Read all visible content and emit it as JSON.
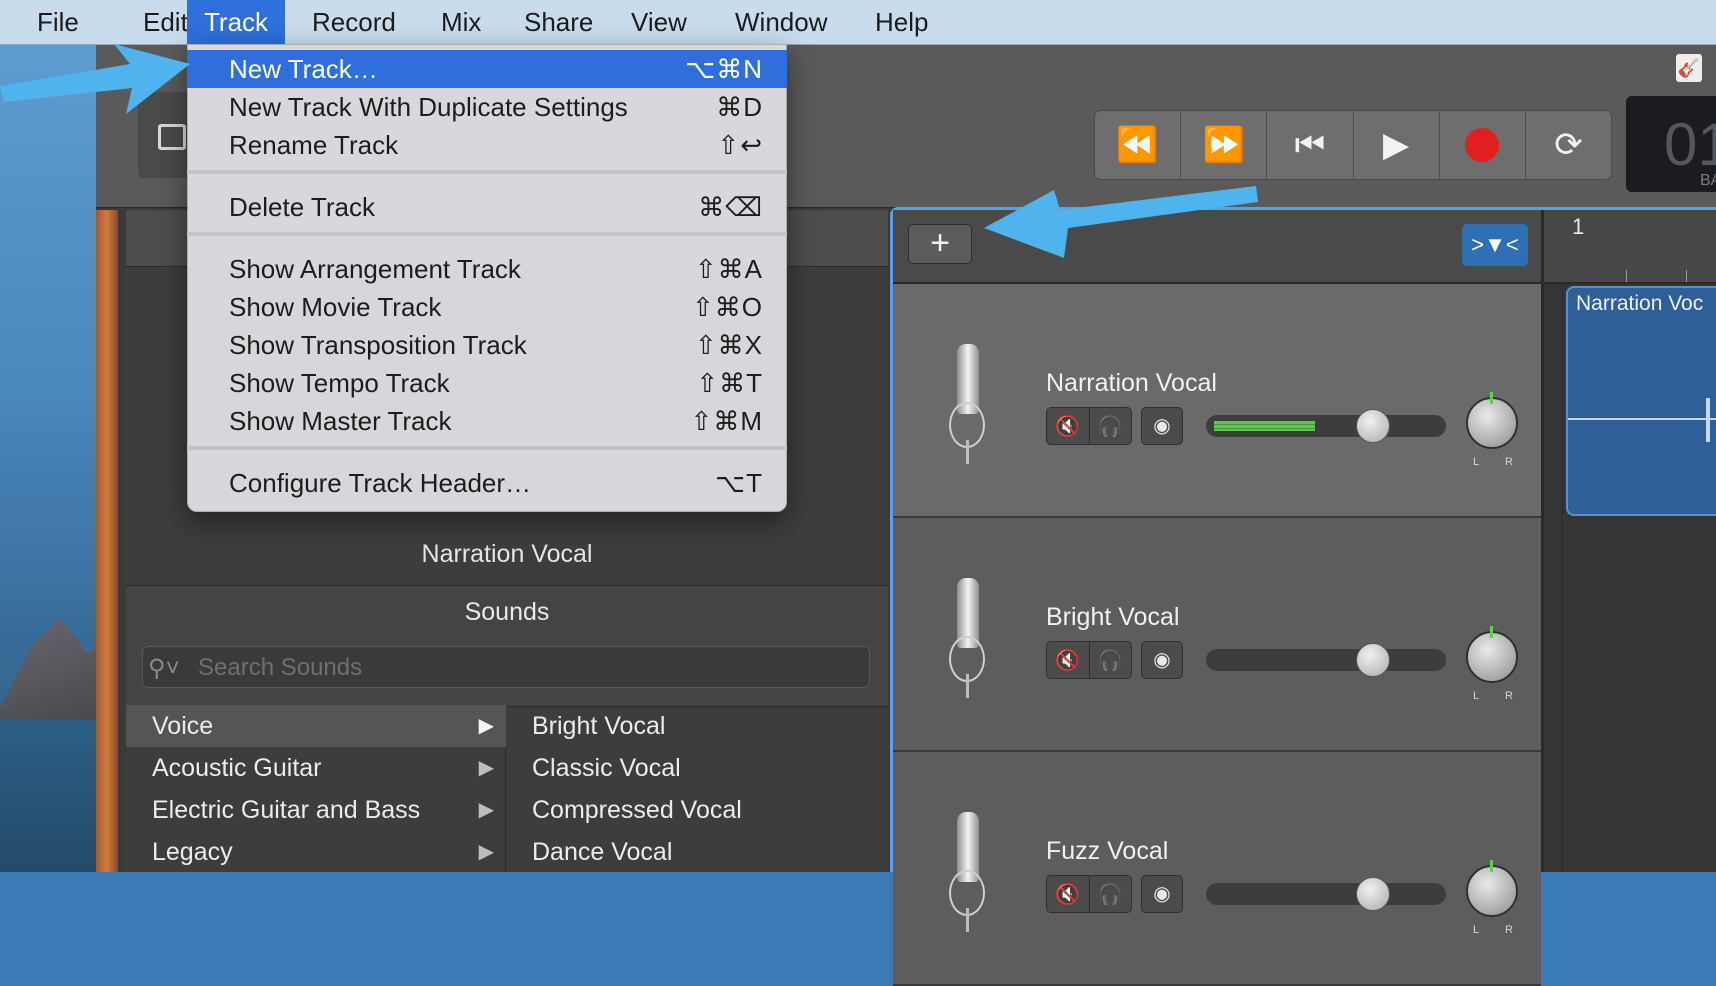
{
  "menubar": {
    "items": [
      "File",
      "Edit",
      "Track",
      "Record",
      "Mix",
      "Share",
      "View",
      "Window",
      "Help"
    ],
    "active": "Track"
  },
  "track_menu": {
    "groups": [
      [
        {
          "label": "New Track…",
          "shortcut": "⌥⌘N",
          "highlighted": true
        },
        {
          "label": "New Track With Duplicate Settings",
          "shortcut": "⌘D"
        },
        {
          "label": "Rename Track",
          "shortcut": "⇧↩"
        }
      ],
      [
        {
          "label": "Delete Track",
          "shortcut": "⌘⌫"
        }
      ],
      [
        {
          "label": "Show Arrangement Track",
          "shortcut": "⇧⌘A"
        },
        {
          "label": "Show Movie Track",
          "shortcut": "⇧⌘O"
        },
        {
          "label": "Show Transposition Track",
          "shortcut": "⇧⌘X"
        },
        {
          "label": "Show Tempo Track",
          "shortcut": "⇧⌘T"
        },
        {
          "label": "Show Master Track",
          "shortcut": "⇧⌘M"
        }
      ],
      [
        {
          "label": "Configure Track Header…",
          "shortcut": "⌥T"
        }
      ]
    ]
  },
  "library": {
    "track_name": "Narration Vocal",
    "sounds_title": "Sounds",
    "search_placeholder": "Search Sounds",
    "categories": [
      {
        "label": "Voice",
        "selected": true
      },
      {
        "label": "Acoustic Guitar"
      },
      {
        "label": "Electric Guitar and Bass"
      },
      {
        "label": "Legacy"
      }
    ],
    "presets": [
      "Bright Vocal",
      "Classic Vocal",
      "Compressed Vocal",
      "Dance Vocal"
    ]
  },
  "tracks": [
    {
      "name": "Narration Vocal",
      "volume_level": 0.45,
      "selected": true
    },
    {
      "name": "Bright Vocal",
      "volume_level": 0
    },
    {
      "name": "Fuzz Vocal",
      "volume_level": 0
    }
  ],
  "pan_labels": {
    "left": "L",
    "right": "R"
  },
  "timeline": {
    "bar": "1",
    "region_name": "Narration Voc"
  },
  "lcd": {
    "value": "01",
    "label": "BA"
  },
  "colors": {
    "accent": "#2f6fdb",
    "annotation_arrow": "#4fb3ee",
    "record": "#e02020",
    "meter": "#58c94c",
    "region": "#2f5f99"
  },
  "icons": {
    "transport": [
      "rewind-icon",
      "fast-forward-icon",
      "go-to-start-icon",
      "play-icon",
      "record-icon",
      "cycle-icon"
    ],
    "track_buttons": [
      "mute-icon",
      "solo-headphones-icon",
      "monitor-icon"
    ]
  }
}
